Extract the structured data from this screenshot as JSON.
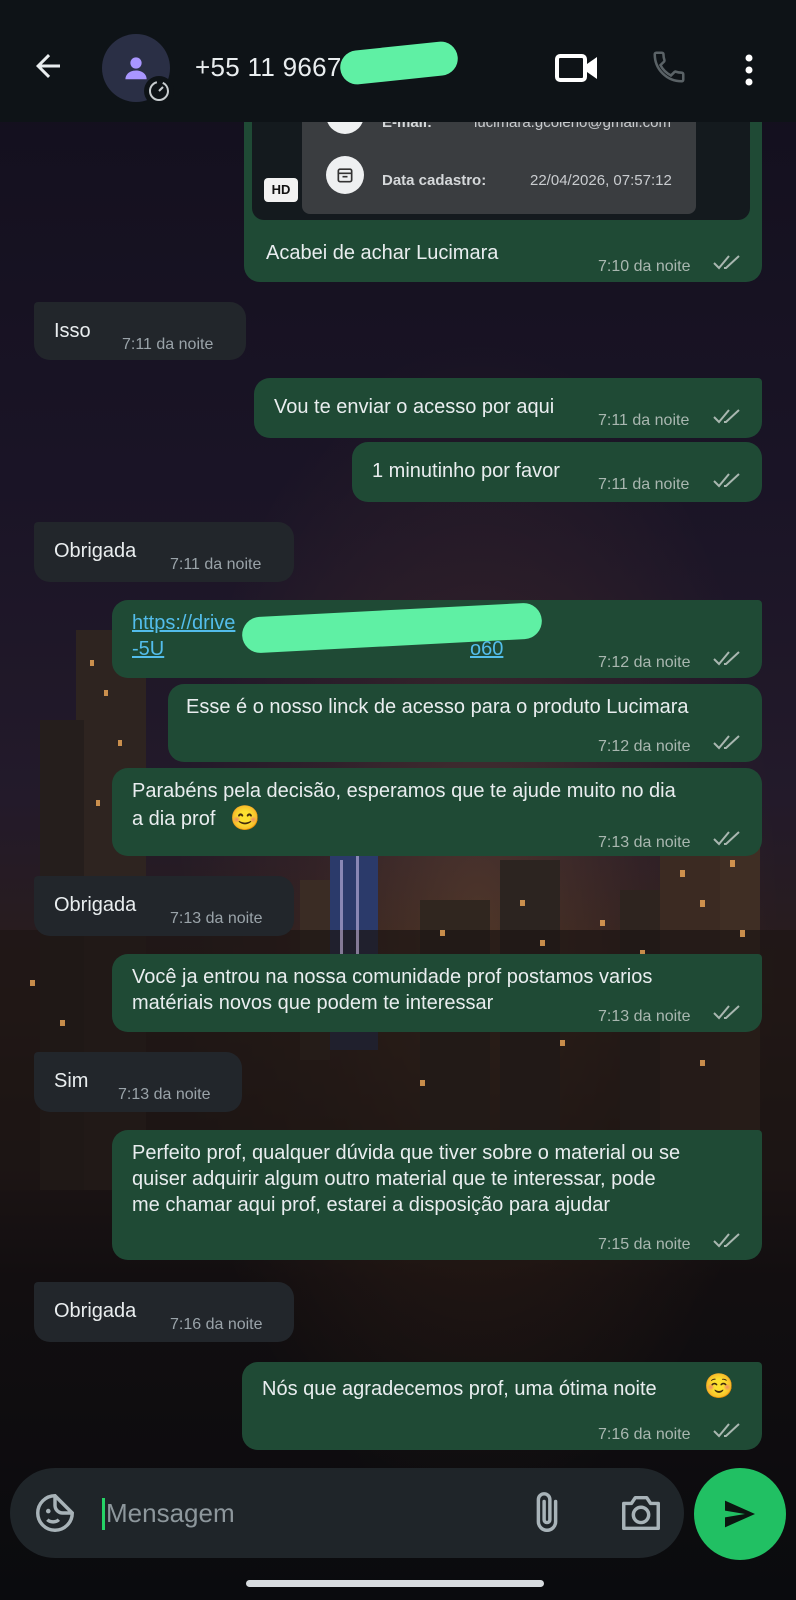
{
  "header": {
    "contact_name": "+55 11 9667",
    "icons": [
      "arrow-left-icon",
      "person-icon",
      "video-call-icon",
      "phone-call-icon",
      "more-vert-icon"
    ]
  },
  "media_preview": {
    "email_label": "E-mail:",
    "email_value": "lucimara.gcoleho@gmail.com",
    "date_label": "Data cadastro:",
    "date_value": "22/04/2026, 07:57:12",
    "quality_badge": "HD"
  },
  "messages": [
    {
      "dir": "out",
      "text": "Acabei de achar Lucimara",
      "time": "7:10 da noite"
    },
    {
      "dir": "in",
      "text": "Isso",
      "time": "7:11 da noite"
    },
    {
      "dir": "out",
      "text": "Vou te enviar o acesso por aqui",
      "time": "7:11 da noite"
    },
    {
      "dir": "out",
      "text": "1 minutinho por favor",
      "time": "7:11 da noite"
    },
    {
      "dir": "in",
      "text": "Obrigada",
      "time": "7:11 da noite"
    },
    {
      "dir": "out",
      "link_line1": "https://drive",
      "link_line2": "-5U",
      "link_line2_end": "o60",
      "time": "7:12 da noite"
    },
    {
      "dir": "out",
      "text": "Esse é o nosso linck de acesso para o produto Lucimara",
      "time": "7:12 da noite"
    },
    {
      "dir": "out",
      "line1": "Parabéns pela decisão, esperamos que te ajude muito no dia",
      "line2": "a dia prof",
      "emoji": "😊",
      "time": "7:13 da noite"
    },
    {
      "dir": "in",
      "text": "Obrigada",
      "time": "7:13 da noite"
    },
    {
      "dir": "out",
      "line1": "Você ja entrou na nossa comunidade prof postamos varios",
      "line2": "matériais novos que podem te interessar",
      "time": "7:13 da noite"
    },
    {
      "dir": "in",
      "text": "Sim",
      "time": "7:13 da noite"
    },
    {
      "dir": "out",
      "line1": "Perfeito prof, qualquer dúvida que tiver sobre o material ou se",
      "line2": "quiser adquirir algum outro material que te interessar, pode",
      "line3": "me chamar aqui prof, estarei a disposição para ajudar",
      "time": "7:15 da noite"
    },
    {
      "dir": "in",
      "text": "Obrigada",
      "time": "7:16 da noite"
    },
    {
      "dir": "out",
      "text": "Nós que agradecemos prof, uma ótima noite",
      "emoji": "☺️",
      "time": "7:16 da noite"
    }
  ],
  "composer": {
    "placeholder": "Mensagem",
    "icons": [
      "sticker-icon",
      "paperclip-icon",
      "camera-icon",
      "send-icon"
    ]
  },
  "colors": {
    "outgoing_bubble": "#1f4a35",
    "incoming_bubble": "#22262b",
    "accent": "#21c063",
    "read_ticks": "#a9b7b0"
  }
}
